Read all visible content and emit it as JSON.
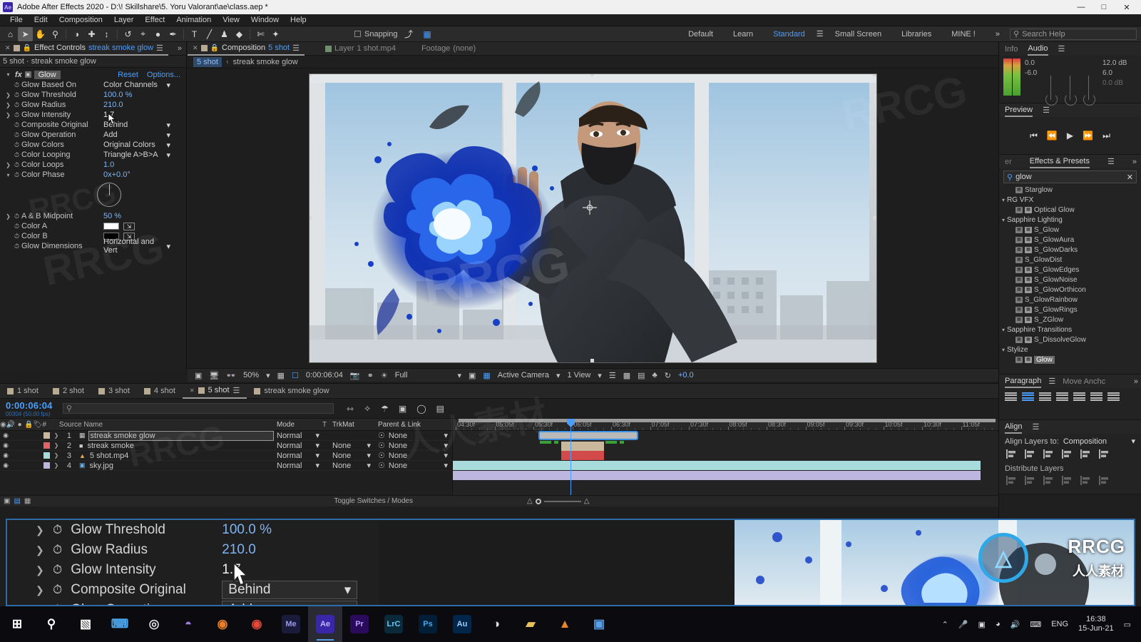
{
  "window": {
    "app_badge": "Ae",
    "title": "Adobe After Effects 2020 - D:\\! Skillshare\\5. Yoru Valorant\\ae\\class.aep *",
    "minimize": "—",
    "maximize": "□",
    "close": "✕"
  },
  "menubar": [
    "File",
    "Edit",
    "Composition",
    "Layer",
    "Effect",
    "Animation",
    "View",
    "Window",
    "Help"
  ],
  "toolbar": {
    "tools": [
      {
        "name": "home-icon",
        "glyph": "⌂"
      },
      {
        "name": "selection-tool-icon",
        "glyph": "➤"
      },
      {
        "name": "hand-tool-icon",
        "glyph": "✋"
      },
      {
        "name": "zoom-tool-icon",
        "glyph": "⚲"
      },
      {
        "name": "orbit-tool-icon",
        "glyph": "◑"
      },
      {
        "name": "pan-behind-tool-icon",
        "glyph": "✚"
      },
      {
        "name": "camera-tool-icon",
        "glyph": "↕"
      },
      {
        "name": "rotation-tool-icon",
        "glyph": "↺"
      },
      {
        "name": "anchor-point-tool-icon",
        "glyph": "⌖"
      },
      {
        "name": "shape-tool-icon",
        "glyph": "●"
      },
      {
        "name": "pen-tool-icon",
        "glyph": "✒"
      },
      {
        "name": "type-tool-icon",
        "glyph": "T"
      },
      {
        "name": "brush-tool-icon",
        "glyph": "╱"
      },
      {
        "name": "clone-stamp-tool-icon",
        "glyph": "♟"
      },
      {
        "name": "eraser-tool-icon",
        "glyph": "◆"
      },
      {
        "name": "roto-brush-tool-icon",
        "glyph": "✄"
      },
      {
        "name": "puppet-tool-icon",
        "glyph": "✦"
      }
    ],
    "snapping_label": "Snapping",
    "workspaces": [
      "Default",
      "Learn",
      "Standard",
      "Small Screen",
      "Libraries",
      "MINE !"
    ],
    "workspace_selected": "Standard",
    "overflow": "»",
    "search_help_placeholder": "Search Help"
  },
  "effect_controls": {
    "tab_title": "Effect Controls",
    "tab_item": "streak smoke glow",
    "subtitle": "5 shot · streak smoke glow",
    "effect_name": "Glow",
    "reset_label": "Reset",
    "options_label": "Options...",
    "properties": [
      {
        "label": "Glow Based On",
        "value": "Color Channels",
        "type": "dropdown",
        "expand": false
      },
      {
        "label": "Glow Threshold",
        "value": "100.0 %",
        "type": "value",
        "expand": true
      },
      {
        "label": "Glow Radius",
        "value": "210.0",
        "type": "value",
        "expand": true
      },
      {
        "label": "Glow Intensity",
        "value": "1.7",
        "type": "value",
        "expand": true
      },
      {
        "label": "Composite Original",
        "value": "Behind",
        "type": "dropdown",
        "expand": false
      },
      {
        "label": "Glow Operation",
        "value": "Add",
        "type": "dropdown",
        "expand": false
      },
      {
        "label": "Glow Colors",
        "value": "Original Colors",
        "type": "dropdown",
        "expand": false
      },
      {
        "label": "Color Looping",
        "value": "Triangle A>B>A",
        "type": "dropdown",
        "expand": false
      },
      {
        "label": "Color Loops",
        "value": "1.0",
        "type": "value",
        "expand": true
      },
      {
        "label": "Color Phase",
        "value": "0x+0.0°",
        "type": "value",
        "expand": true
      },
      {
        "label": "A & B Midpoint",
        "value": "50 %",
        "type": "value",
        "expand": true
      },
      {
        "label": "Color A",
        "value": "#FFFFFF",
        "type": "color",
        "expand": false
      },
      {
        "label": "Color B",
        "value": "#000000",
        "type": "color",
        "expand": false
      },
      {
        "label": "Glow Dimensions",
        "value": "Horizontal and Vert",
        "type": "dropdown",
        "expand": false
      }
    ]
  },
  "composition": {
    "tabs": [
      {
        "label": "Composition",
        "item": "5 shot",
        "active": true
      },
      {
        "label": "Layer",
        "item": "1 shot.mp4",
        "active": false
      },
      {
        "label": "Footage",
        "item": "(none)",
        "active": false
      }
    ],
    "breadcrumb": [
      "5 shot",
      "streak smoke glow"
    ],
    "bottom_bar": {
      "magnification": "50%",
      "time": "0:00:06:04",
      "resolution": "Full",
      "camera": "Active Camera",
      "views": "1 View",
      "exposure": "+0.0"
    }
  },
  "right": {
    "info_tab": "Info",
    "audio_tab": "Audio",
    "audio_levels": {
      "top": "0.0",
      "bottom": "-6.0",
      "right_top": "12.0 dB",
      "right_mid": "6.0",
      "right_bot": "0.0 dB"
    },
    "preview_tab": "Preview",
    "preview_buttons": [
      "⏮",
      "⏪",
      "▶",
      "⏩",
      "⏭"
    ],
    "effects_tabs": {
      "left_cut": "er",
      "main": "Effects & Presets",
      "overflow": "»"
    },
    "effects_search": "glow",
    "effects_list": [
      {
        "label": "Starglow",
        "type": "item",
        "indent": 2,
        "icons": 1
      },
      {
        "label": "RG VFX",
        "type": "group",
        "indent": 0
      },
      {
        "label": "Optical Glow",
        "type": "item",
        "indent": 2,
        "icons": 2
      },
      {
        "label": "Sapphire Lighting",
        "type": "group",
        "indent": 0
      },
      {
        "label": "S_Glow",
        "type": "item",
        "indent": 2,
        "icons": 2
      },
      {
        "label": "S_GlowAura",
        "type": "item",
        "indent": 2,
        "icons": 2
      },
      {
        "label": "S_GlowDarks",
        "type": "item",
        "indent": 2,
        "icons": 2
      },
      {
        "label": "S_GlowDist",
        "type": "item",
        "indent": 2,
        "icons": 1
      },
      {
        "label": "S_GlowEdges",
        "type": "item",
        "indent": 2,
        "icons": 2
      },
      {
        "label": "S_GlowNoise",
        "type": "item",
        "indent": 2,
        "icons": 2
      },
      {
        "label": "S_GlowOrthicon",
        "type": "item",
        "indent": 2,
        "icons": 2
      },
      {
        "label": "S_GlowRainbow",
        "type": "item",
        "indent": 2,
        "icons": 1
      },
      {
        "label": "S_GlowRings",
        "type": "item",
        "indent": 2,
        "icons": 2
      },
      {
        "label": "S_ZGlow",
        "type": "item",
        "indent": 2,
        "icons": 2
      },
      {
        "label": "Sapphire Transitions",
        "type": "group",
        "indent": 0
      },
      {
        "label": "S_DissolveGlow",
        "type": "item",
        "indent": 2,
        "icons": 2
      },
      {
        "label": "Stylize",
        "type": "group",
        "indent": 0
      },
      {
        "label": "Glow",
        "type": "item",
        "indent": 2,
        "icons": 2,
        "selected": true
      }
    ],
    "paragraph_tab": "Paragraph",
    "move_anchor_tab": "Move Anchc",
    "align_tab": "Align",
    "align_layers_label": "Align Layers to:",
    "align_layers_value": "Composition",
    "distribute_label": "Distribute Layers"
  },
  "timeline": {
    "tabs": [
      {
        "label": "1 shot",
        "active": false
      },
      {
        "label": "2 shot",
        "active": false
      },
      {
        "label": "3 shot",
        "active": false
      },
      {
        "label": "4 shot",
        "active": false
      },
      {
        "label": "5 shot",
        "active": true
      },
      {
        "label": "streak smoke glow",
        "active": false
      }
    ],
    "current_time": "0:00:06:04",
    "frame_info": "00304 (50.00 fps)",
    "search_placeholder": "",
    "columns": {
      "source_name": "Source Name",
      "mode": "Mode",
      "t": "T",
      "trkmat": "TrkMat",
      "parent": "Parent & Link"
    },
    "layers": [
      {
        "index": "1",
        "name": "streak smoke glow",
        "mode": "Normal",
        "trkmat": "",
        "parent": "None",
        "color": "#c9b89c",
        "selected": true,
        "icon": "comp"
      },
      {
        "index": "2",
        "name": "streak smoke",
        "mode": "Normal",
        "trkmat": "None",
        "parent": "None",
        "color": "#e06464",
        "selected": false,
        "icon": "solid"
      },
      {
        "index": "3",
        "name": "5 shot.mp4",
        "mode": "Normal",
        "trkmat": "None",
        "parent": "None",
        "color": "#a8dcdc",
        "selected": false,
        "icon": "video"
      },
      {
        "index": "4",
        "name": "sky.jpg",
        "mode": "Normal",
        "trkmat": "None",
        "parent": "None",
        "color": "#bcb6e0",
        "selected": false,
        "icon": "image"
      }
    ],
    "ruler_ticks": [
      "04:30f",
      "05:05f",
      "05:30f",
      "06:05f",
      "06:30f",
      "07:05f",
      "07:30f",
      "08:05f",
      "08:30f",
      "09:05f",
      "09:30f",
      "10:05f",
      "10:30f",
      "11:05f"
    ],
    "toggle_switches_label": "Toggle Switches / Modes"
  },
  "magnifier": {
    "rows": [
      {
        "label": "Glow Threshold",
        "value": "100.0 %",
        "type": "value"
      },
      {
        "label": "Glow Radius",
        "value": "210.0",
        "type": "value"
      },
      {
        "label": "Glow Intensity",
        "value": "1.7",
        "type": "value"
      },
      {
        "label": "Composite Original",
        "value": "Behind",
        "type": "dropdown"
      },
      {
        "label": "Glow Operation",
        "value": "Add",
        "type": "dropdown"
      }
    ]
  },
  "taskbar": {
    "apps": [
      {
        "name": "start-button",
        "label": "⊞",
        "color": "#ffffff",
        "bg": "transparent"
      },
      {
        "name": "search-icon",
        "label": "⚲",
        "color": "#ffffff",
        "bg": "transparent"
      },
      {
        "name": "task-view-icon",
        "label": "▧",
        "color": "#ffffff",
        "bg": "transparent"
      },
      {
        "name": "explorer-icon",
        "label": "⌨",
        "color": "#4aa3e8",
        "bg": "transparent"
      },
      {
        "name": "obs-icon",
        "label": "◎",
        "color": "#dddddd",
        "bg": "transparent"
      },
      {
        "name": "brave-icon",
        "label": "◓",
        "color": "#a07de0",
        "bg": "transparent"
      },
      {
        "name": "blender-icon",
        "label": "◉",
        "color": "#e87d2a",
        "bg": "transparent"
      },
      {
        "name": "chrome-icon",
        "label": "◉",
        "color": "#e84a3a",
        "bg": "transparent"
      },
      {
        "name": "media-encoder-icon",
        "label": "Me",
        "color": "#9a9ae8",
        "bg": "#1a1a3a"
      },
      {
        "name": "after-effects-icon",
        "label": "Ae",
        "color": "#c3b6ff",
        "bg": "#3a26a8",
        "active": true
      },
      {
        "name": "premiere-icon",
        "label": "Pr",
        "color": "#b8a0ff",
        "bg": "#2a0a5a"
      },
      {
        "name": "lightroom-icon",
        "label": "LrC",
        "color": "#6ac8f0",
        "bg": "#0a2a3a"
      },
      {
        "name": "photoshop-icon",
        "label": "Ps",
        "color": "#4aa8e8",
        "bg": "#001e36"
      },
      {
        "name": "audition-icon",
        "label": "Au",
        "color": "#9acfff",
        "bg": "#00264a"
      },
      {
        "name": "audio-app-icon",
        "label": "◑",
        "color": "#dddddd",
        "bg": "transparent"
      },
      {
        "name": "folder-icon",
        "label": "▰",
        "color": "#e8c05a",
        "bg": "transparent"
      },
      {
        "name": "vlc-icon",
        "label": "▲",
        "color": "#e8862a",
        "bg": "transparent"
      },
      {
        "name": "app-icon",
        "label": "▣",
        "color": "#5aa0e8",
        "bg": "transparent"
      }
    ],
    "tray": [
      "⌃",
      "⌕",
      "⌨",
      "◔",
      "♪",
      "⌨"
    ],
    "language": "ENG",
    "time": "16:38",
    "date": "15-Jun-21",
    "notification": "▭"
  },
  "watermarks": {
    "rrcg": "RRCG",
    "cn": "人人素材"
  }
}
